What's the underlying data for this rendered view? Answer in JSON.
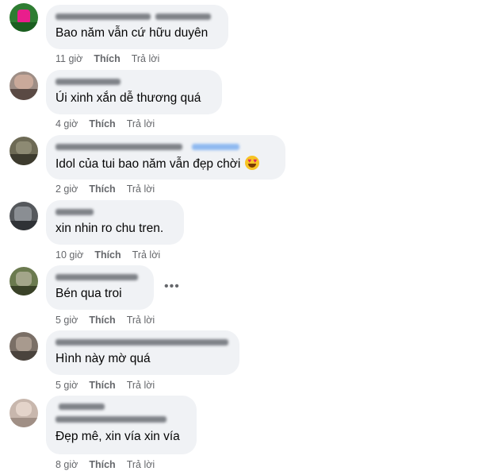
{
  "actions": {
    "like": "Thích",
    "reply": "Trả lời"
  },
  "more_icon": "more-horizontal-icon",
  "comments": [
    {
      "text": "Bao năm vẫn cứ hữu duyên",
      "time": "11 giờ",
      "avatar_color": "#2e7d32"
    },
    {
      "text": "Úi xinh xắn dễ thương quá",
      "time": "4 giờ",
      "avatar_color": "#9e8e86"
    },
    {
      "text": "Idol của tui bao năm vẫn đẹp chời",
      "time": "2 giờ",
      "avatar_color": "#6d6a55",
      "emoji": "heart-eyes-emoji"
    },
    {
      "text": "xin nhin ro chu tren.",
      "time": "10 giờ",
      "avatar_color": "#55585c"
    },
    {
      "text": "Bén qua troi",
      "time": "5 giờ",
      "avatar_color": "#6b7a4f"
    },
    {
      "text": "Hình này mờ quá",
      "time": "5 giờ",
      "avatar_color": "#7a6f66"
    },
    {
      "text": "Đẹp mê, xin vía xin vía",
      "time": "8 giờ",
      "avatar_color": "#c8b7ad"
    }
  ]
}
